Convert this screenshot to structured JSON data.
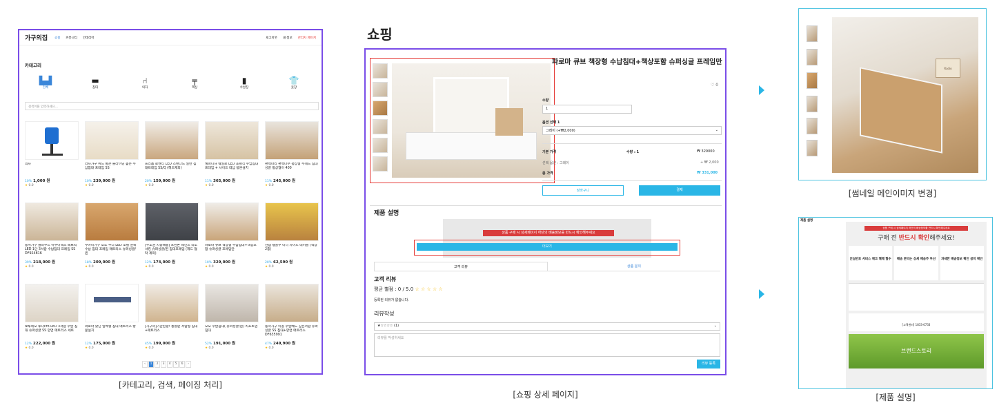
{
  "panel1": {
    "caption": "[카테고리, 검색, 페이징 처리]",
    "nav": {
      "logo": "가구의집",
      "links": [
        "쇼핑",
        "커뮤니티",
        "인테리어"
      ],
      "right": [
        "로그아웃",
        "내 정보",
        "관리자 페이지"
      ]
    },
    "category_title": "카테고리",
    "categories": [
      {
        "label": "전체",
        "icon": "all-furniture-icon"
      },
      {
        "label": "침대",
        "icon": "bed-icon"
      },
      {
        "label": "의자",
        "icon": "chair-icon"
      },
      {
        "label": "책상",
        "icon": "desk-icon"
      },
      {
        "label": "수납장",
        "icon": "cabinet-icon"
      },
      {
        "label": "옷장",
        "icon": "wardrobe-icon"
      }
    ],
    "search_placeholder": "검색어를 입력하세요...",
    "products": [
      {
        "name": "의자",
        "discount": "10%",
        "price": "1,000 원",
        "rating": "0.0"
      },
      {
        "name": "라자가구 위드 통큰 슬라이딩 높은 수납침대 프레임 SS",
        "discount": "10%",
        "price": "239,000 원",
        "rating": "0.0"
      },
      {
        "name": "프리폼 로엔티 LED 스탠다드 일반 침대프레임 SS/Q (헤드제외)",
        "discount": "20%",
        "price": "159,000 원",
        "rating": "0.0"
      },
      {
        "name": "웰퍼니처 웨일로 LED 호텔식 수납침대 프레임 + 사이드 테납 방문설치",
        "discount": "11%",
        "price": "365,000 원",
        "rating": "0.0"
      },
      {
        "name": "편백마리 편백나무 평상형 무헤드 침대 싱글 평상형이 400",
        "discount": "11%",
        "price": "245,000 원",
        "rating": "0.0"
      },
      {
        "name": "동서가구 클라우드 아쿠이텍스 페브릭 LED 1단 3서랍 수납침대 프레임 SS DF924816",
        "discount": "39%",
        "price": "218,000 원",
        "rating": "0.0"
      },
      {
        "name": "우아미가구 모노 우디 LED 호텔 원목 수납 침대 프레임 매트리스 슈퍼싱글/퀸",
        "discount": "18%",
        "price": "209,000 원",
        "rating": "0.0"
      },
      {
        "name": "[수도권 지정배송] 프린톤 웨인스 리노셔킹 슈퍼싱글/퀸 침대프레임 (헤드 협탁 제외)",
        "discount": "12%",
        "price": "174,000 원",
        "rating": "0.0"
      },
      {
        "name": "파로마 큐브 책장형 수납침대+책상포함 슈퍼싱글 프레임만",
        "discount": "10%",
        "price": "329,000 원",
        "rating": "0.0"
      },
      {
        "name": "한샘 뱅골우 미니 사이드 테이블 (색상 2종)",
        "discount": "20%",
        "price": "62,590 원",
        "rating": "0.0"
      },
      {
        "name": "보루네오 루나Pro LED 3서랍 수납 침대 슈퍼싱글 SS 양면 매트리스 세트",
        "discount": "12%",
        "price": "222,000 원",
        "rating": "0.0"
      },
      {
        "name": "퍼로마 맞닌 일체형 침대 매트리스 방문설치",
        "discount": "12%",
        "price": "175,000 원",
        "rating": "0.0"
      },
      {
        "name": "[가구야]기관된항! 통잘판 서랍형 침대+매트리스",
        "discount": "45%",
        "price": "199,000 원",
        "rating": "0.0"
      },
      {
        "name": "오모 수납침대( 슈퍼싱글/퀸) 리프트업 침대",
        "discount": "52%",
        "price": "191,000 원",
        "rating": "0.0"
      },
      {
        "name": "동서가구 이총 수납베드 깊은서랍 슈퍼싱글 SS 침대+양면 매트리스 DF635991",
        "discount": "47%",
        "price": "249,900 원",
        "rating": "0.0"
      }
    ],
    "pages": [
      "‹",
      "1",
      "2",
      "3",
      "4",
      "5",
      "6",
      "›"
    ]
  },
  "panel2": {
    "section_title": "쇼핑",
    "caption": "[쇼핑 상세 페이지]",
    "product_title": "파로마 큐브 책장형 수납침대+책상포함 슈퍼싱글 프레임만",
    "likes": "♡ 0",
    "qty_label": "수량",
    "qty_value": "1",
    "option_label": "옵션 선택 1",
    "option_value": "그레이 (+₩2,000)",
    "base_price_label": "기본 가격",
    "qty_summary": "수량 : 1",
    "base_price": "₩ 329000",
    "selected_option_label": "선택 옵션 : 그레이",
    "selected_option_price": "+ ₩ 2,000",
    "total_label": "총 가격",
    "total_price": "₩ 331,000",
    "cart_button": "장바구니",
    "buy_button": "결제",
    "desc_title": "제품 설명",
    "warning_text": "상품 구매 시 상세페이지 하단의 배송정보를 반드시 확인해주세요",
    "more_button": "더보기",
    "tab_review": "고객 리뷰",
    "tab_qna": "상품 문의",
    "review_title": "고객 리뷰",
    "avg_rating": "평균 별점 : 0 / 5.0",
    "stars_empty": "☆ ☆ ☆ ☆ ☆",
    "no_review": "등록된 리뷰가 없습니다.",
    "write_title": "리뷰작성",
    "rating_select": "★☆☆☆☆ (1)",
    "review_placeholder": "리뷰를 작성하세요",
    "submit_button": "리뷰 등록"
  },
  "panel3": {
    "thumb_caption": "[썸네일 메인이미지 변경]",
    "desc_caption": "[제품 설명]",
    "desc_header": "제품 설명",
    "radio_text": "Radio",
    "banner_top": "상품 구매 시 상세페이지 하단의 배송정보를 반드시 확인해주세요",
    "banner_main_pre": "구매 전 ",
    "banner_main_red": "반드시 확인",
    "banner_main_post": "해주세요!",
    "col1_title": "안심번호 서비스 체크 해제 필수",
    "col2_title": "배송 문의는 상세 배송주 우선",
    "col3_title": "자세한 배송정보 확인 공지 확인",
    "brand_story": "브랜드스토리",
    "phone": "[고객센터] 1833-0733"
  },
  "colors": {
    "accent_purple": "#7a4de8",
    "accent_blue": "#2ab6e6",
    "highlight_red": "#e53935",
    "link_blue": "#3a86d9"
  }
}
